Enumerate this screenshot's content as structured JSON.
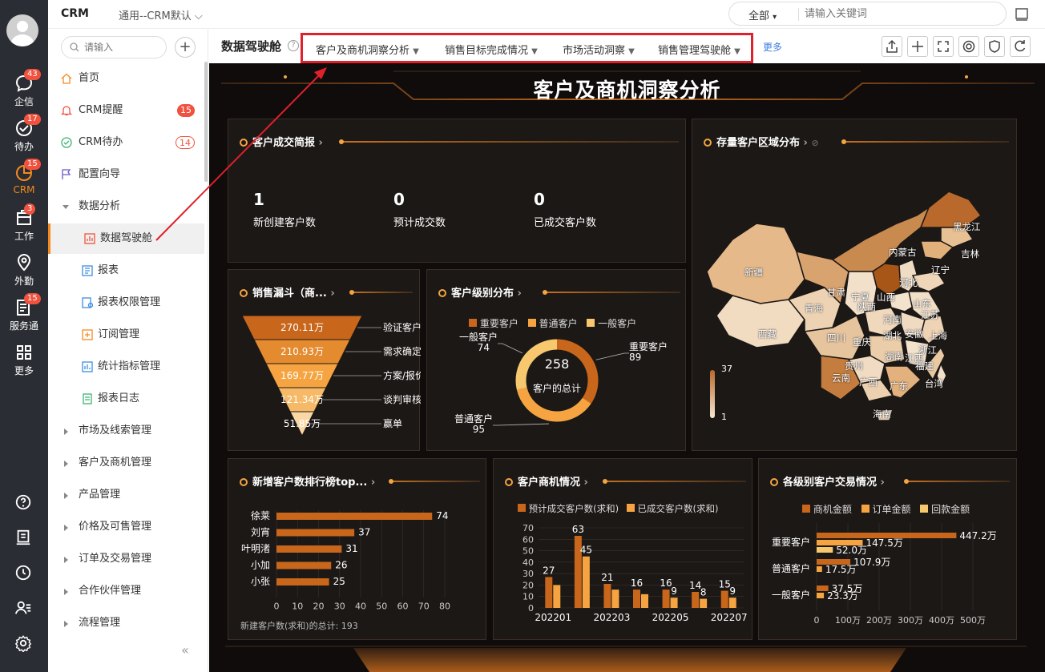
{
  "rail": {
    "items": [
      {
        "label": "企信",
        "badge": "43",
        "icon": "chat-icon"
      },
      {
        "label": "待办",
        "badge": "17",
        "icon": "check-circle-icon"
      },
      {
        "label": "CRM",
        "badge": "15",
        "icon": "crm-pie-icon"
      },
      {
        "label": "工作",
        "badge": "3",
        "icon": "briefcase-icon"
      },
      {
        "label": "外勤",
        "badge": "",
        "icon": "location-icon"
      },
      {
        "label": "服务通",
        "badge": "15",
        "icon": "service-icon"
      },
      {
        "label": "更多",
        "badge": "",
        "icon": "grid-icon"
      }
    ]
  },
  "topbar": {
    "app": "CRM",
    "view": "通用--CRM默认",
    "scope": "全部",
    "search_placeholder": "请输入关键词"
  },
  "sidebar": {
    "search_placeholder": "请输入",
    "items": [
      {
        "label": "首页",
        "icon": "home-icon"
      },
      {
        "label": "CRM提醒",
        "icon": "bell-icon",
        "count": "15"
      },
      {
        "label": "CRM待办",
        "icon": "todo-icon",
        "count": "14"
      },
      {
        "label": "配置向导",
        "icon": "flag-icon"
      },
      {
        "label": "数据分析",
        "icon": ""
      },
      {
        "label": "数据驾驶舱",
        "icon": "dashboard-icon"
      },
      {
        "label": "报表",
        "icon": "report-icon"
      },
      {
        "label": "报表权限管理",
        "icon": "report-permission-icon"
      },
      {
        "label": "订阅管理",
        "icon": "subscribe-icon"
      },
      {
        "label": "统计指标管理",
        "icon": "metric-icon"
      },
      {
        "label": "报表日志",
        "icon": "log-icon"
      },
      {
        "label": "市场及线索管理",
        "icon": ""
      },
      {
        "label": "客户及商机管理",
        "icon": ""
      },
      {
        "label": "产品管理",
        "icon": ""
      },
      {
        "label": "价格及可售管理",
        "icon": ""
      },
      {
        "label": "订单及交易管理",
        "icon": ""
      },
      {
        "label": "合作伙伴管理",
        "icon": ""
      },
      {
        "label": "流程管理",
        "icon": ""
      }
    ],
    "collapse": "«"
  },
  "header": {
    "title": "数据驾驶舱",
    "tabs": [
      "客户及商机洞察分析",
      "销售目标完成情况",
      "市场活动洞察",
      "销售管理驾驶舱"
    ],
    "more": "更多"
  },
  "dashboard": {
    "title": "客户及商机洞察分析",
    "kpi": {
      "title": "客户成交简报",
      "items": [
        {
          "value": "1",
          "label": "新创建客户数"
        },
        {
          "value": "0",
          "label": "预计成交数"
        },
        {
          "value": "0",
          "label": "已成交客户数"
        }
      ]
    },
    "map": {
      "title": "存量客户区域分布",
      "scale_max": "37",
      "scale_min": "1",
      "regions": [
        "黑龙江",
        "吉林",
        "辽宁",
        "内蒙古",
        "新疆",
        "甘肃",
        "宁夏",
        "山西",
        "河北",
        "山东",
        "青海",
        "陕西",
        "河南",
        "江苏",
        "西藏",
        "四川",
        "湖北",
        "安徽",
        "上海",
        "重庆",
        "浙江",
        "湖南",
        "江西",
        "贵州",
        "福建",
        "云南",
        "广西",
        "广东",
        "台湾",
        "海南"
      ]
    },
    "funnel": {
      "title": "销售漏斗（商...",
      "stages": [
        {
          "value": "270.11万",
          "label": "验证客户"
        },
        {
          "value": "210.93万",
          "label": "需求确定"
        },
        {
          "value": "169.77万",
          "label": "方案/报价"
        },
        {
          "value": "121.34万",
          "label": "谈判审核"
        },
        {
          "value": "51.85万",
          "label": "赢单"
        }
      ]
    },
    "donut": {
      "title": "客户级别分布",
      "legend": [
        "重要客户",
        "普通客户",
        "一般客户"
      ],
      "total": "258",
      "total_label": "客户的总计",
      "slices": [
        {
          "name": "重要客户",
          "value": 89,
          "color": "#c8661b"
        },
        {
          "name": "普通客户",
          "value": 95,
          "color": "#f5a441"
        },
        {
          "name": "一般客户",
          "value": 74,
          "color": "#f7c86e"
        }
      ]
    },
    "ranking": {
      "title": "新增客户数排行榜top...",
      "footer": "新建客户数(求和)的总计: 193"
    },
    "opportunity": {
      "title": "客户商机情况",
      "legend": [
        "预计成交客户数(求和)",
        "已成交客户数(求和)"
      ]
    },
    "trade": {
      "title": "各级别客户交易情况",
      "legend": [
        "商机金额",
        "订单金额",
        "回款金额"
      ]
    }
  },
  "chart_data": [
    {
      "type": "bar",
      "orientation": "horizontal",
      "title": "新增客户数排行榜top...",
      "categories": [
        "徐莱",
        "刘宵",
        "叶明渚",
        "小加",
        "小张"
      ],
      "values": [
        74,
        37,
        31,
        26,
        25
      ],
      "xlim": [
        0,
        80
      ],
      "xticks": [
        "0",
        "10",
        "20",
        "30",
        "40",
        "50",
        "60",
        "70",
        "80"
      ]
    },
    {
      "type": "bar",
      "title": "客户商机情况",
      "categories": [
        "202201",
        "202202",
        "202203",
        "202204",
        "202205",
        "202206",
        "202207"
      ],
      "xticks": [
        "202201",
        "202203",
        "202205",
        "202207"
      ],
      "series": [
        {
          "name": "预计成交客户数(求和)",
          "values": [
            27,
            63,
            21,
            16,
            16,
            14,
            15
          ],
          "color": "#c8661b"
        },
        {
          "name": "已成交客户数(求和)",
          "values": [
            20,
            45,
            16,
            12,
            9,
            8,
            9
          ],
          "color": "#f5a441"
        }
      ],
      "data_labels": [
        "27",
        "",
        "63",
        "45",
        "21",
        "",
        "16",
        "",
        "16",
        "9",
        "14",
        "8",
        "15",
        "9"
      ],
      "ylim": [
        0,
        70
      ],
      "yticks": [
        "0",
        "10",
        "20",
        "30",
        "40",
        "50",
        "60",
        "70"
      ]
    },
    {
      "type": "bar",
      "orientation": "horizontal",
      "title": "各级别客户交易情况",
      "categories": [
        "重要客户",
        "普通客户",
        "一般客户"
      ],
      "series": [
        {
          "name": "商机金额",
          "values": [
            447.2,
            107.9,
            37.5
          ],
          "labels": [
            "447.2万",
            "107.9万",
            "37.5万"
          ],
          "color": "#c8661b"
        },
        {
          "name": "订单金额",
          "values": [
            147.5,
            17.5,
            23.3
          ],
          "labels": [
            "147.5万",
            "17.5万",
            "23.3万"
          ],
          "color": "#f5a441"
        },
        {
          "name": "回款金额",
          "values": [
            52.0,
            0,
            0
          ],
          "labels": [
            "52.0万",
            "",
            ""
          ],
          "color": "#f7c86e"
        }
      ],
      "xlim": [
        0,
        500
      ],
      "xticks": [
        "0",
        "100万",
        "200万",
        "300万",
        "400万",
        "500万"
      ]
    }
  ]
}
